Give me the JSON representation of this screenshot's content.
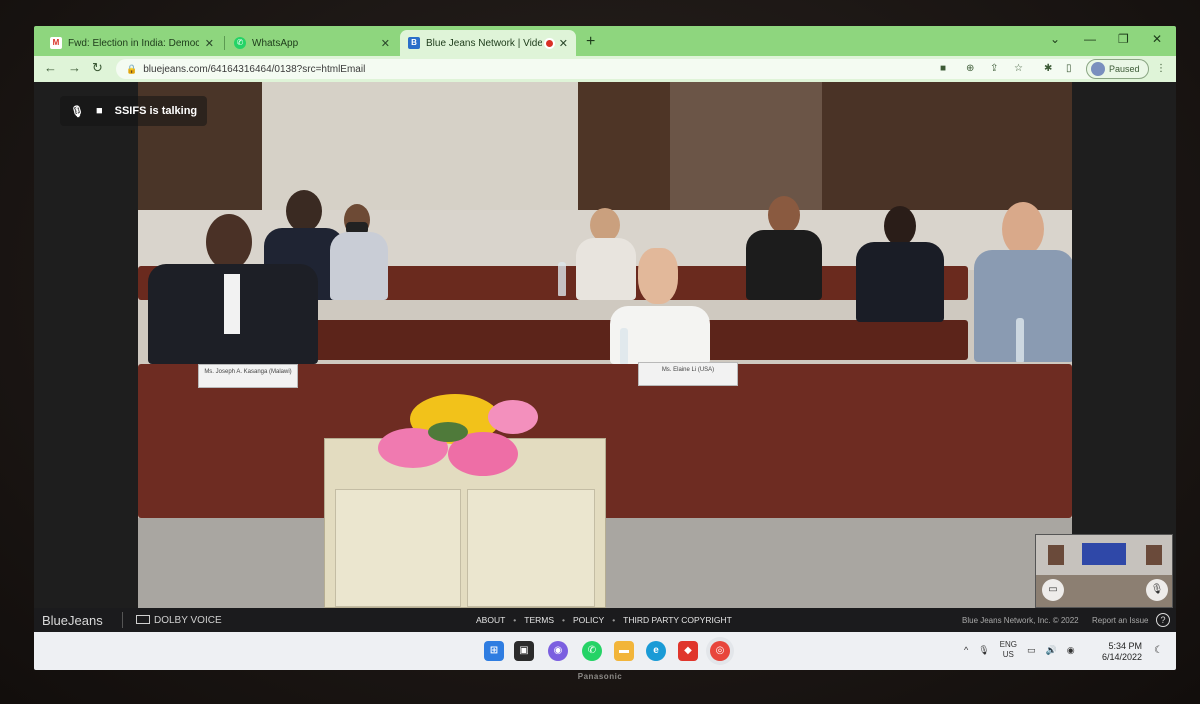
{
  "browser": {
    "tabs": [
      {
        "title": "Fwd: Election in India: Democrac",
        "favicon": "gmail-icon"
      },
      {
        "title": "WhatsApp",
        "favicon": "whatsapp-icon"
      },
      {
        "title": "Blue Jeans Network | Video C",
        "favicon": "bluejeans-icon",
        "active": true,
        "recording": true
      }
    ],
    "url": "bluejeans.com/64164316464/0138?src=htmlEmail",
    "profile_status": "Paused"
  },
  "meeting": {
    "talking_indicator": "SSIFS is talking",
    "nameplates": [
      "Ms. Joseph A. Kasanga (Malawi)",
      "Ms. Elaine Li (USA)"
    ]
  },
  "footer": {
    "logo": "BlueJeans",
    "dolby": "DOLBY VOICE",
    "links": [
      "ABOUT",
      "TERMS",
      "POLICY",
      "THIRD PARTY COPYRIGHT"
    ],
    "copyright": "Blue Jeans Network, Inc. © 2022",
    "report": "Report an Issue"
  },
  "taskbar": {
    "lang_line1": "ENG",
    "lang_line2": "US",
    "time": "5:34 PM",
    "date": "6/14/2022"
  },
  "monitor_brand": "Panasonic",
  "colors": {
    "tab_strip": "#8ed67e",
    "toolbar": "#dff4d8",
    "recording_dot": "#d93025"
  }
}
